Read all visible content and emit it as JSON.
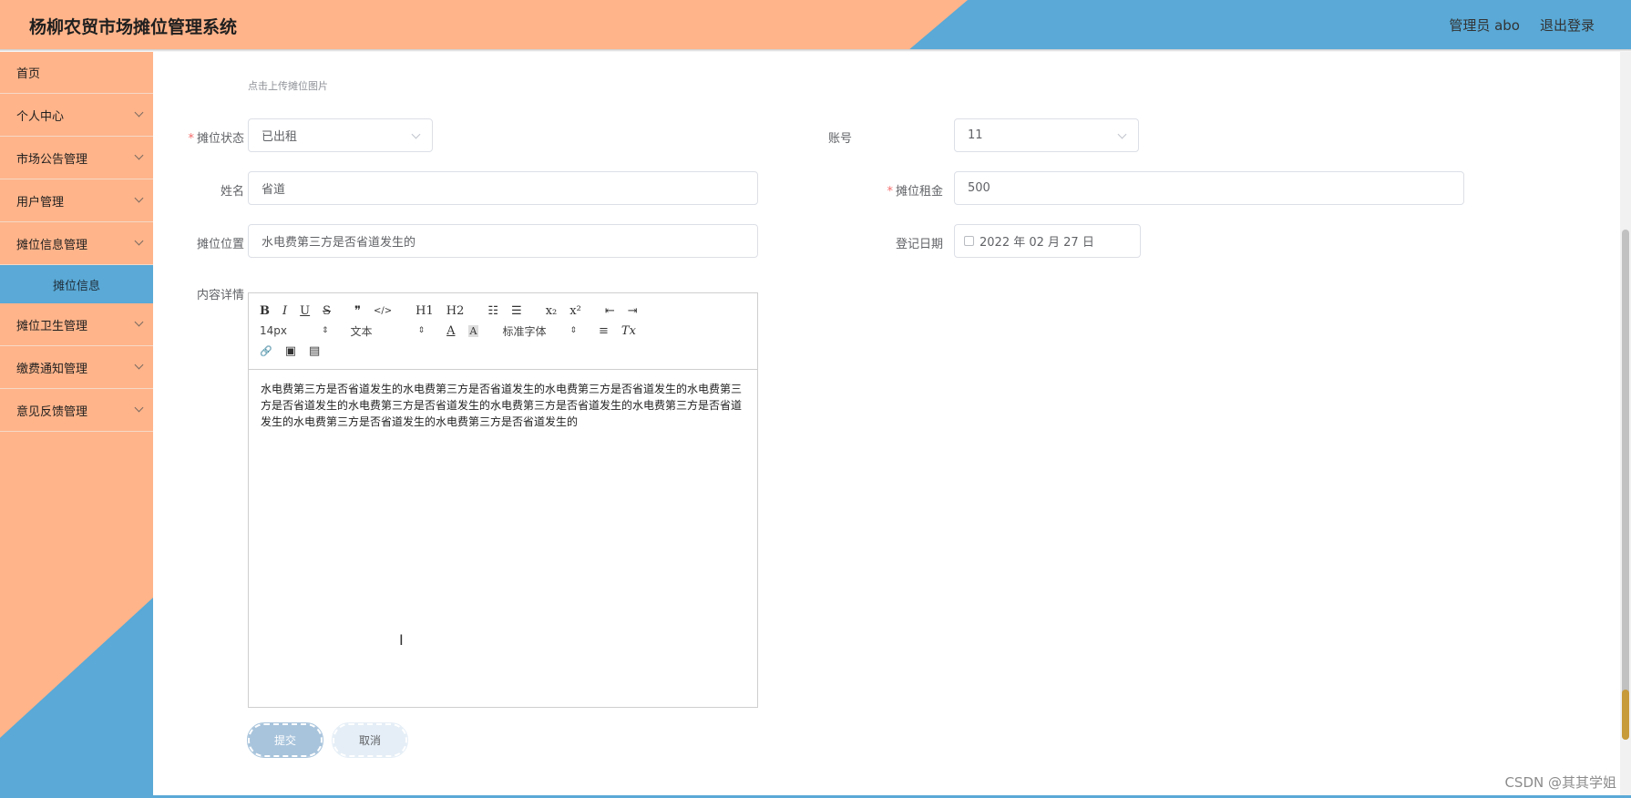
{
  "app": {
    "title": "杨柳农贸市场摊位管理系统",
    "user_label": "管理员 abo",
    "logout_label": "退出登录"
  },
  "colors": {
    "peach": "#ffb48a",
    "blue": "#5aa9d6",
    "required": "#f56c6c"
  },
  "sidebar": {
    "items": [
      {
        "label": "首页",
        "has_children": false
      },
      {
        "label": "个人中心",
        "has_children": true
      },
      {
        "label": "市场公告管理",
        "has_children": true
      },
      {
        "label": "用户管理",
        "has_children": true
      },
      {
        "label": "摊位信息管理",
        "has_children": true,
        "expanded": true
      },
      {
        "label": "摊位卫生管理",
        "has_children": true
      },
      {
        "label": "缴费通知管理",
        "has_children": true
      },
      {
        "label": "意见反馈管理",
        "has_children": true
      }
    ],
    "active_sub": "摊位信息"
  },
  "form": {
    "upload_hint": "点击上传摊位图片",
    "status": {
      "label": "摊位状态",
      "value": "已出租",
      "required": true
    },
    "account": {
      "label": "账号",
      "value": "11"
    },
    "name": {
      "label": "姓名",
      "value": "省道"
    },
    "rent": {
      "label": "摊位租金",
      "value": "500",
      "required": true
    },
    "location": {
      "label": "摊位位置",
      "value": "水电费第三方是否省道发生的"
    },
    "date": {
      "label": "登记日期",
      "value": "2022 年 02 月 27 日"
    },
    "content": {
      "label": "内容详情",
      "text": "水电费第三方是否省道发生的水电费第三方是否省道发生的水电费第三方是否省道发生的水电费第三方是否省道发生的水电费第三方是否省道发生的水电费第三方是否省道发生的水电费第三方是否省道发生的水电费第三方是否省道发生的水电费第三方是否省道发生的"
    },
    "toolbar": {
      "bold": "B",
      "italic": "I",
      "underline": "U",
      "strike": "S",
      "quote": "❞",
      "code": "</>",
      "h1": "H1",
      "h2": "H2",
      "ol": "☷",
      "ul": "☰",
      "sub": "x₂",
      "sup": "x²",
      "outdent": "⇤",
      "indent": "⇥",
      "size": "14px",
      "header": "文本",
      "color": "A",
      "bg": "A",
      "font": "标准字体",
      "align": "≡",
      "clean": "Tx",
      "link": "🔗",
      "image": "▣",
      "video": "▤"
    },
    "submit_label": "提交",
    "cancel_label": "取消"
  },
  "watermark": "CSDN @其其学姐"
}
